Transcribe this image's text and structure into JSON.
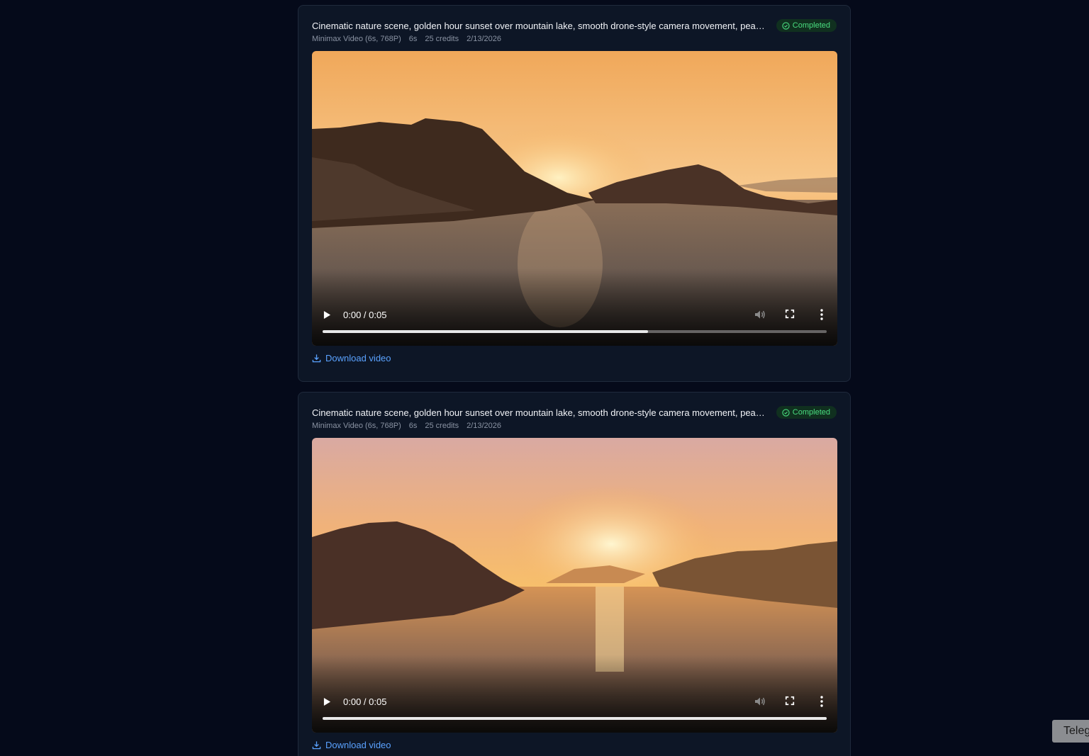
{
  "cards": [
    {
      "prompt": "Cinematic nature scene, golden hour sunset over mountain lake, smooth drone-style camera movement, peac…",
      "status": "Completed",
      "meta": {
        "model": "Minimax Video (6s, 768P)",
        "duration": "6s",
        "credits": "25 credits",
        "date": "2/13/2026"
      },
      "video": {
        "time": "0:00 / 0:05",
        "progress": 0.645
      },
      "download_label": "Download video"
    },
    {
      "prompt": "Cinematic nature scene, golden hour sunset over mountain lake, smooth drone-style camera movement, peac…",
      "status": "Completed",
      "meta": {
        "model": "Minimax Video (6s, 768P)",
        "duration": "6s",
        "credits": "25 credits",
        "date": "2/13/2026"
      },
      "video": {
        "time": "0:00 / 0:05",
        "progress": 1.0
      },
      "download_label": "Download video"
    }
  ],
  "floating_button": {
    "label": "Telegram"
  },
  "colors": {
    "background": "#050a1a",
    "card": "#0d1626",
    "status_green": "#4ade80",
    "link_blue": "#5aa2ff"
  },
  "icons": [
    "check-circle-icon",
    "play-icon",
    "volume-icon",
    "fullscreen-icon",
    "more-vertical-icon",
    "download-icon"
  ]
}
